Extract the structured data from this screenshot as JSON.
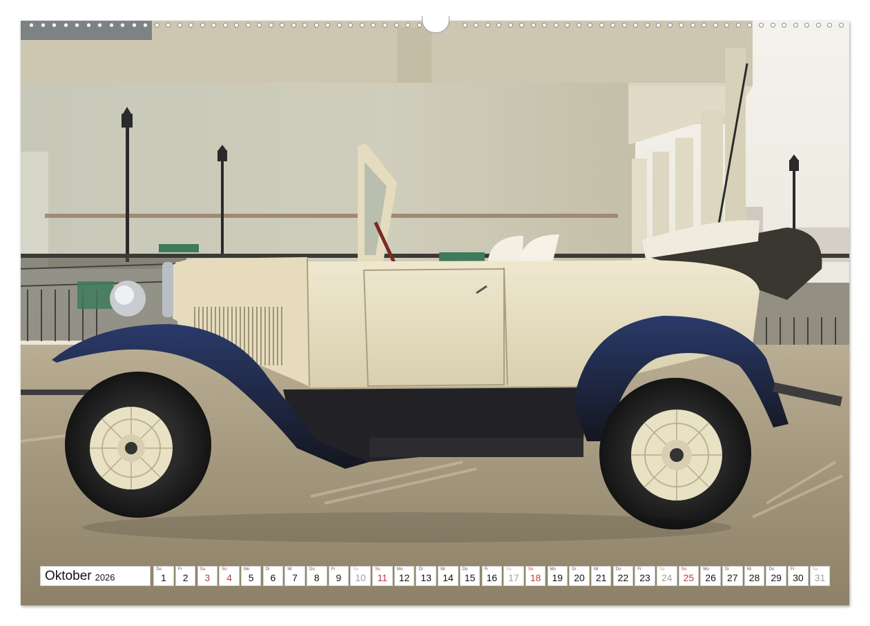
{
  "calendar": {
    "month": "Oktober",
    "year": "2026",
    "days": [
      {
        "wd": "Do",
        "n": "1",
        "type": "weekday"
      },
      {
        "wd": "Fr",
        "n": "2",
        "type": "weekday"
      },
      {
        "wd": "Sa",
        "n": "3",
        "type": "sat"
      },
      {
        "wd": "So",
        "n": "4",
        "type": "sun"
      },
      {
        "wd": "Mo",
        "n": "5",
        "type": "weekday"
      },
      {
        "wd": "Di",
        "n": "6",
        "type": "weekday"
      },
      {
        "wd": "Mi",
        "n": "7",
        "type": "weekday"
      },
      {
        "wd": "Do",
        "n": "8",
        "type": "weekday"
      },
      {
        "wd": "Fr",
        "n": "9",
        "type": "weekday"
      },
      {
        "wd": "Sa",
        "n": "10",
        "type": "holiday"
      },
      {
        "wd": "So",
        "n": "11",
        "type": "sun"
      },
      {
        "wd": "Mo",
        "n": "12",
        "type": "weekday"
      },
      {
        "wd": "Di",
        "n": "13",
        "type": "weekday"
      },
      {
        "wd": "Mi",
        "n": "14",
        "type": "weekday"
      },
      {
        "wd": "Do",
        "n": "15",
        "type": "weekday"
      },
      {
        "wd": "Fr",
        "n": "16",
        "type": "weekday"
      },
      {
        "wd": "Sa",
        "n": "17",
        "type": "holiday"
      },
      {
        "wd": "So",
        "n": "18",
        "type": "sun"
      },
      {
        "wd": "Mo",
        "n": "19",
        "type": "weekday"
      },
      {
        "wd": "Di",
        "n": "20",
        "type": "weekday"
      },
      {
        "wd": "Mi",
        "n": "21",
        "type": "weekday"
      },
      {
        "wd": "Do",
        "n": "22",
        "type": "weekday"
      },
      {
        "wd": "Fr",
        "n": "23",
        "type": "weekday"
      },
      {
        "wd": "Sa",
        "n": "24",
        "type": "holiday"
      },
      {
        "wd": "So",
        "n": "25",
        "type": "sun"
      },
      {
        "wd": "Mo",
        "n": "26",
        "type": "weekday"
      },
      {
        "wd": "Di",
        "n": "27",
        "type": "weekday"
      },
      {
        "wd": "Mi",
        "n": "28",
        "type": "weekday"
      },
      {
        "wd": "Do",
        "n": "29",
        "type": "weekday"
      },
      {
        "wd": "Fr",
        "n": "30",
        "type": "weekday"
      },
      {
        "wd": "Sa",
        "n": "31",
        "type": "holiday"
      }
    ]
  },
  "colors": {
    "car_body": "#e8dfc2",
    "fender": "#1c2336",
    "wall": "#c9c7b3",
    "sky": "#efece2",
    "road": "#a69a7f",
    "weekend_red": "#c23b3b"
  },
  "binding": {
    "hole_count": 72
  }
}
